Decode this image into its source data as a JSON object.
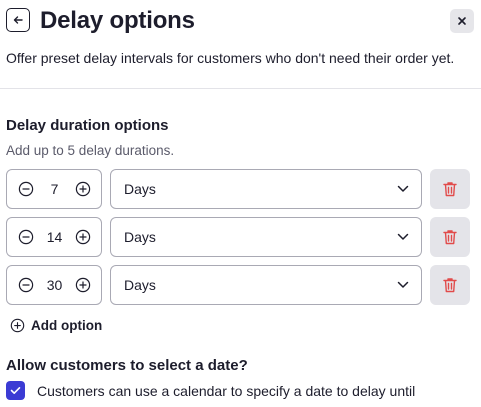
{
  "header": {
    "title": "Delay options",
    "back_icon": "arrow-left-icon",
    "close_icon": "close-icon"
  },
  "subtitle": "Offer preset delay intervals for customers who don't need their order yet.",
  "durations": {
    "title": "Delay duration options",
    "hint": "Add up to 5 delay durations.",
    "rows": [
      {
        "value": "7",
        "unit": "Days"
      },
      {
        "value": "14",
        "unit": "Days"
      },
      {
        "value": "30",
        "unit": "Days"
      }
    ],
    "add_label": "Add option"
  },
  "date_select": {
    "title": "Allow customers to select a date?",
    "checkbox_label": "Customers can use a calendar to specify a date to delay until",
    "checked": true
  },
  "colors": {
    "text": "#1d1d2c",
    "muted": "#5b5b6b",
    "delete_icon": "#e14b4b",
    "checkbox": "#3b3bd4",
    "border": "#a9a9b4"
  }
}
